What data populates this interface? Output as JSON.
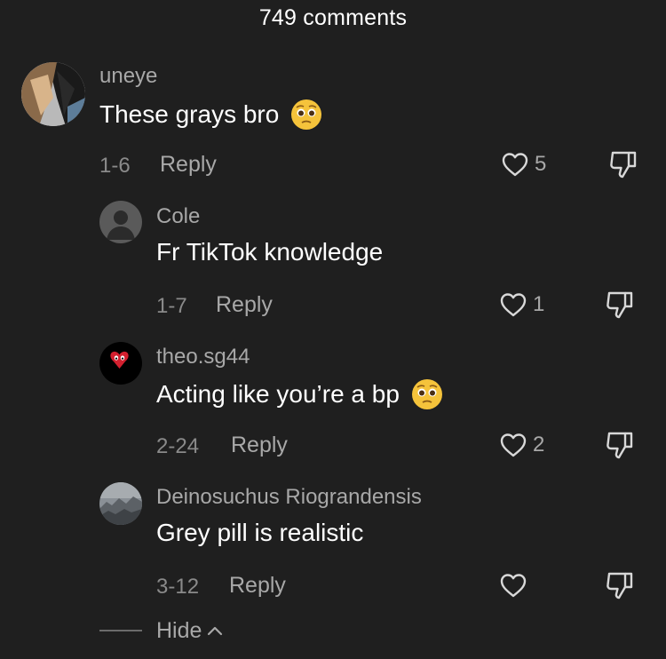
{
  "header": {
    "title": "749 comments"
  },
  "comments": [
    {
      "username": "uneye",
      "text": "These grays bro",
      "emoji": "pleading-face-emoji",
      "date": "1-6",
      "reply_label": "Reply",
      "likes": "5"
    },
    {
      "username": "Cole",
      "text": "Fr TikTok knowledge",
      "date": "1-7",
      "reply_label": "Reply",
      "likes": "1"
    },
    {
      "username": "theo.sg44",
      "text": "Acting like you’re a bp",
      "emoji": "pleading-face-emoji",
      "date": "2-24",
      "reply_label": "Reply",
      "likes": "2"
    },
    {
      "username": "Deinosuchus Riograndensis",
      "text": "Grey pill is realistic",
      "date": "3-12",
      "reply_label": "Reply",
      "likes": ""
    }
  ],
  "hide": {
    "label": "Hide"
  },
  "colors": {
    "background": "#1f1f1f",
    "primary_text": "#ffffff",
    "secondary_text": "#a8a8a8",
    "tertiary_text": "#8a8a8a"
  }
}
